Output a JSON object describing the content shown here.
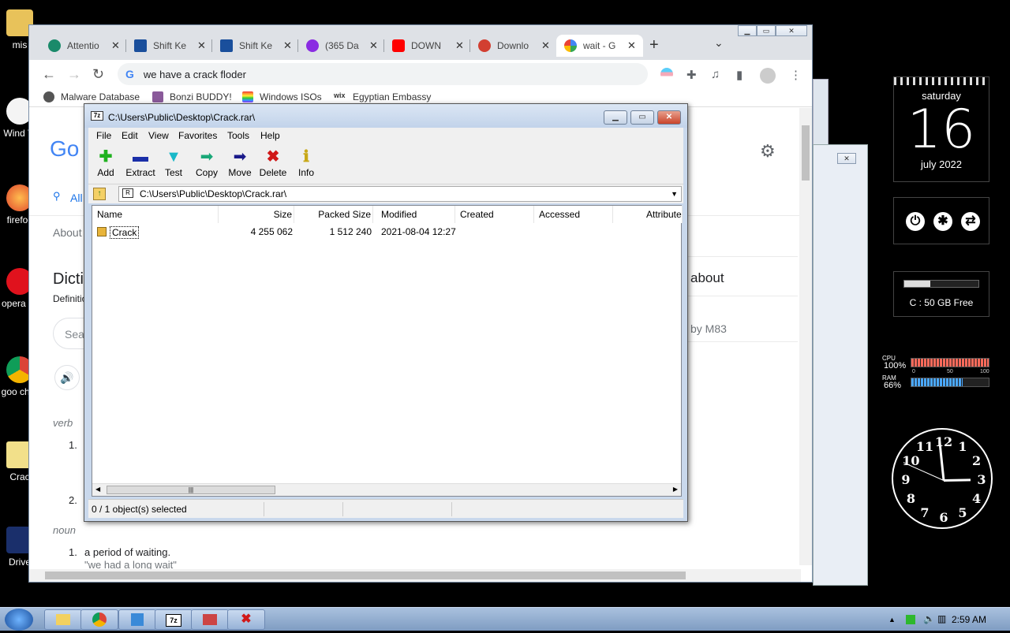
{
  "desktop": {
    "icons": [
      {
        "label": "mis"
      },
      {
        "label": "Wind Vi"
      },
      {
        "label": "firefoc"
      },
      {
        "label": "opera ss"
      },
      {
        "label": "goo chro"
      },
      {
        "label": "Crac"
      },
      {
        "label": "Drive"
      }
    ]
  },
  "chrome": {
    "tabs": [
      {
        "title": "Attentio",
        "color": "#1a8a6a"
      },
      {
        "title": "Shift Ke",
        "color": "#1a4f9c"
      },
      {
        "title": "Shift Ke",
        "color": "#1a4f9c"
      },
      {
        "title": "(365 Da",
        "color": "#8a2be2"
      },
      {
        "title": "DOWN",
        "color": "#ff0000"
      },
      {
        "title": "Downlo",
        "color": "#d23f31"
      },
      {
        "title": "wait - G",
        "color": "#4285f4"
      }
    ],
    "new_tab": "+",
    "tab_list": "⌄",
    "omnibox": {
      "icon": "G",
      "text": "we have a crack floder"
    },
    "bookmarks": [
      {
        "label": "Malware Database",
        "color": "#555"
      },
      {
        "label": "Bonzi BUDDY!",
        "color": "#8a5a9a"
      },
      {
        "label": "Windows ISOs",
        "color": "#e33"
      },
      {
        "label": "Egyptian Embassy",
        "color": "#333"
      }
    ],
    "page": {
      "logo": "Go",
      "all_tab": "All",
      "about": "About",
      "dict": "Dicti",
      "definition": "Definitio",
      "search_ph": "Sea",
      "verb": "verb",
      "n1": "1.",
      "n2": "2.",
      "noun": "noun",
      "noun1": "1.",
      "noun1_text": "a period of waiting.",
      "noun1_example": "\"we had a long wait\"",
      "right_about": "about",
      "right_by": "by M83"
    }
  },
  "zip": {
    "title": "C:\\Users\\Public\\Desktop\\Crack.rar\\",
    "menu": [
      "File",
      "Edit",
      "View",
      "Favorites",
      "Tools",
      "Help"
    ],
    "tools": [
      {
        "label": "Add",
        "glyph": "+",
        "color": "#1fb21f"
      },
      {
        "label": "Extract",
        "glyph": "▬",
        "color": "#1a2fa8"
      },
      {
        "label": "Test",
        "glyph": "▼",
        "color": "#18b8c8"
      },
      {
        "label": "Copy",
        "glyph": "➡",
        "color": "#1aa878"
      },
      {
        "label": "Move",
        "glyph": "➡",
        "color": "#1a1a8a"
      },
      {
        "label": "Delete",
        "glyph": "✖",
        "color": "#d01818"
      },
      {
        "label": "Info",
        "glyph": "ℹ",
        "color": "#c8a818"
      }
    ],
    "address": "C:\\Users\\Public\\Desktop\\Crack.rar\\",
    "columns": [
      "Name",
      "Size",
      "Packed Size",
      "Modified",
      "Created",
      "Accessed",
      "Attribute"
    ],
    "rows": [
      {
        "name": "Crack",
        "size": "4 255 062",
        "packed": "1 512 240",
        "modified": "2021-08-04 12:27"
      }
    ],
    "status": "0 / 1 object(s) selected"
  },
  "gadgets": {
    "calendar": {
      "weekday": "saturday",
      "day": "16",
      "month_year": "july 2022"
    },
    "disk": {
      "text": "C : 50 GB Free",
      "used_fraction": 0.35
    },
    "cpu": {
      "label": "CPU",
      "percent": "100%",
      "value": 100,
      "color": "#ff6a5a"
    },
    "ram": {
      "label": "RAM",
      "percent": "66%",
      "value": 66,
      "color": "#4aa8ff"
    },
    "scale": [
      "0",
      "50",
      "100"
    ],
    "clock_numbers": [
      "12",
      "1",
      "2",
      "3",
      "4",
      "5",
      "6",
      "7",
      "8",
      "9",
      "10",
      "11"
    ]
  },
  "taskbar": {
    "time": "2:59 AM"
  }
}
